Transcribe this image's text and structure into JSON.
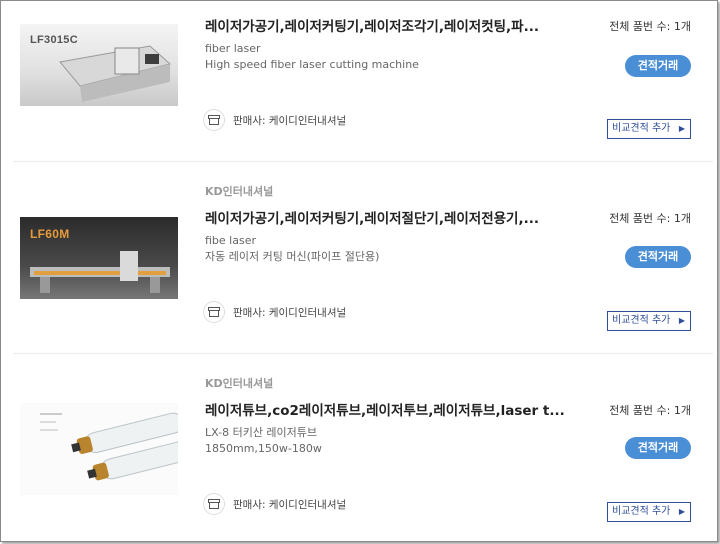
{
  "products": [
    {
      "seller_top": "",
      "thumb_label": "LF3015C",
      "title": "레이저가공기,레이저커팅기,레이저조각기,레이저컷팅,파...",
      "desc_line1": "fiber laser",
      "desc_line2": "High speed fiber laser cutting machine",
      "count": "전체 품번 수: 1개",
      "quote_label": "견적거래",
      "seller": "판매사: 케이디인터내셔널",
      "compare_label": "비교견적 추가",
      "compare_arrow": "▶"
    },
    {
      "seller_top": "KD인터내셔널",
      "thumb_label": "LF60M",
      "title": "레이저가공기,레이저커팅기,레이저절단기,레이저전용기,...",
      "desc_line1": "fibe laser",
      "desc_line2": "자동 레이저 커팅 머신(파이프 절단용)",
      "count": "전체 품번 수: 1개",
      "quote_label": "견적거래",
      "seller": "판매사: 케이디인터내셔널",
      "compare_label": "비교견적 추가",
      "compare_arrow": "▶"
    },
    {
      "seller_top": "KD인터내셔널",
      "thumb_label": "",
      "title": "레이저튜브,co2레이저튜브,레이저투브,레이저튜브,laser t...",
      "desc_line1": "LX-8 터키산 레이저튜브",
      "desc_line2": "1850mm,150w-180w",
      "count": "전체 품번 수: 1개",
      "quote_label": "견적거래",
      "seller": "판매사: 케이디인터내셔널",
      "compare_label": "비교견적 추가",
      "compare_arrow": "▶"
    }
  ]
}
